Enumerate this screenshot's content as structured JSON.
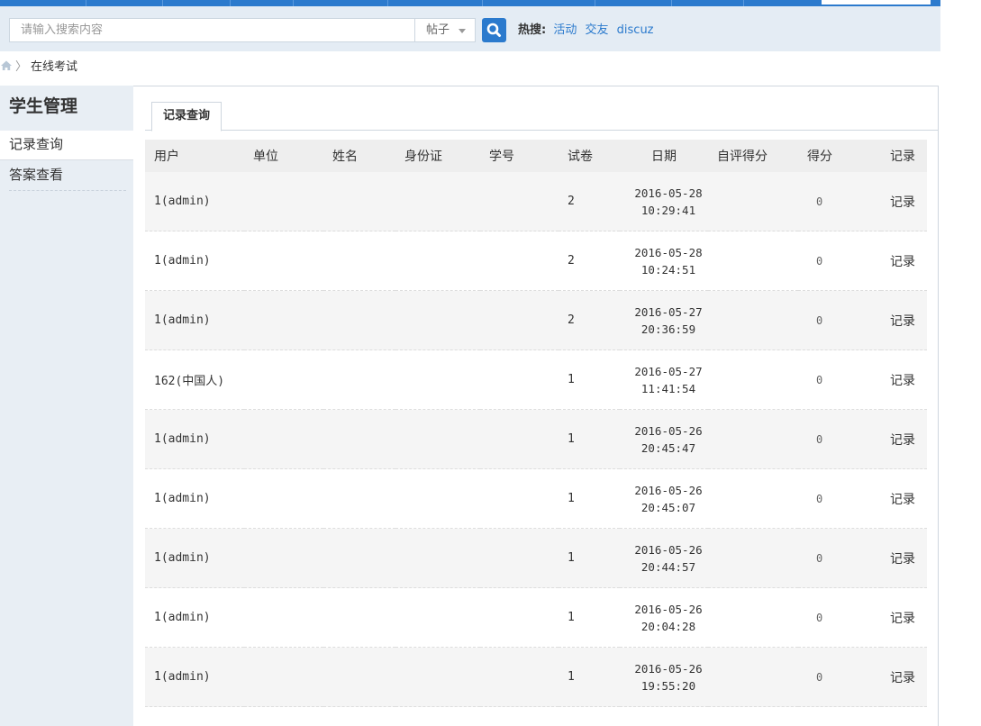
{
  "search": {
    "placeholder": "请输入搜索内容",
    "type_selected": "帖子",
    "hot_label": "热搜:",
    "hot_links": [
      "活动",
      "交友",
      "discuz"
    ]
  },
  "breadcrumb": {
    "current": "在线考试"
  },
  "sidebar": {
    "title": "学生管理",
    "items": [
      {
        "label": "记录查询",
        "active": true
      },
      {
        "label": "答案查看",
        "active": false
      }
    ]
  },
  "main": {
    "tab": "记录查询",
    "columns": [
      "用户",
      "单位",
      "姓名",
      "身份证",
      "学号",
      "试卷",
      "日期",
      "自评得分",
      "得分",
      "记录"
    ],
    "rows": [
      {
        "user": "1(admin)",
        "paper": "2",
        "date": "2016-05-28",
        "time": "10:29:41",
        "score": "0",
        "record": "记录"
      },
      {
        "user": "1(admin)",
        "paper": "2",
        "date": "2016-05-28",
        "time": "10:24:51",
        "score": "0",
        "record": "记录"
      },
      {
        "user": "1(admin)",
        "paper": "2",
        "date": "2016-05-27",
        "time": "20:36:59",
        "score": "0",
        "record": "记录"
      },
      {
        "user": "162(中国人)",
        "paper": "1",
        "date": "2016-05-27",
        "time": "11:41:54",
        "score": "0",
        "record": "记录"
      },
      {
        "user": "1(admin)",
        "paper": "1",
        "date": "2016-05-26",
        "time": "20:45:47",
        "score": "0",
        "record": "记录"
      },
      {
        "user": "1(admin)",
        "paper": "1",
        "date": "2016-05-26",
        "time": "20:45:07",
        "score": "0",
        "record": "记录"
      },
      {
        "user": "1(admin)",
        "paper": "1",
        "date": "2016-05-26",
        "time": "20:44:57",
        "score": "0",
        "record": "记录"
      },
      {
        "user": "1(admin)",
        "paper": "1",
        "date": "2016-05-26",
        "time": "20:04:28",
        "score": "0",
        "record": "记录"
      },
      {
        "user": "1(admin)",
        "paper": "1",
        "date": "2016-05-26",
        "time": "19:55:20",
        "score": "0",
        "record": "记录"
      }
    ]
  },
  "colors": {
    "accent": "#2b7acd",
    "sidebar_bg": "#e8eef4",
    "searchbar_bg": "#e4ecf4"
  },
  "icons": {
    "home": "home-icon",
    "search": "search-icon",
    "caret": "chevron-down-icon"
  }
}
